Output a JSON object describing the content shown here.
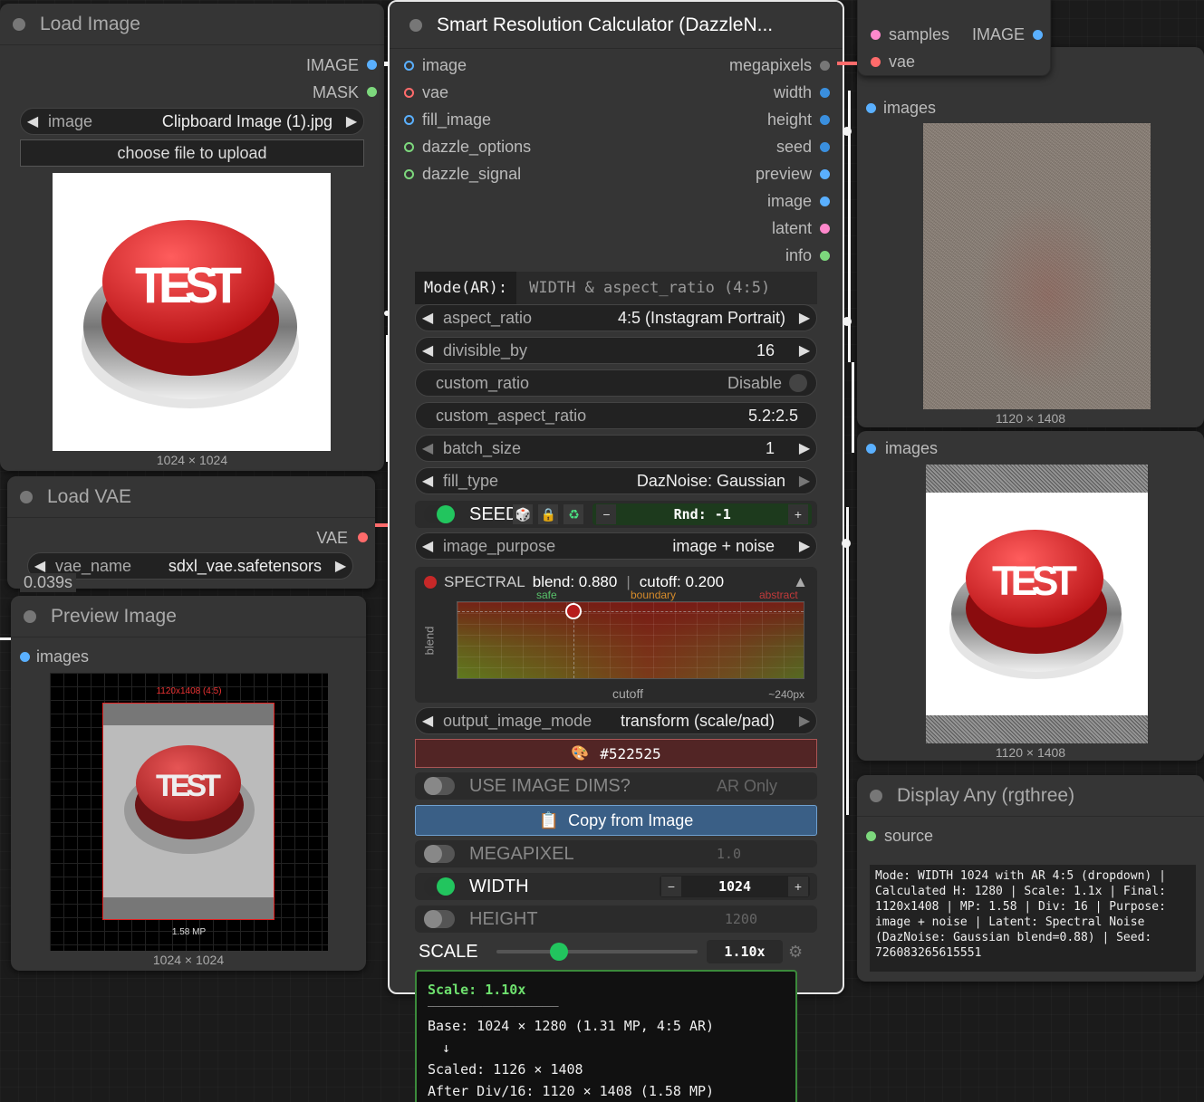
{
  "load_image": {
    "title": "Load Image",
    "outputs": [
      {
        "label": "IMAGE",
        "color": "#5ab0ff"
      },
      {
        "label": "MASK",
        "color": "#7dd87d"
      }
    ],
    "image_widget": {
      "label": "image",
      "value": "Clipboard Image (1).jpg"
    },
    "upload_button": "choose file to upload",
    "preview_button_text": "TEST",
    "dims": "1024 × 1024"
  },
  "load_vae": {
    "title": "Load VAE",
    "output": {
      "label": "VAE",
      "color": "#ff6b6b"
    },
    "vae_widget": {
      "label": "vae_name",
      "value": "sdxl_vae.safetensors"
    },
    "timing": "0.039s"
  },
  "preview_image": {
    "title": "Preview Image",
    "input": {
      "label": "images",
      "color": "#5ab0ff"
    },
    "overlay_label": "1120x1408 (4:5)",
    "overlay_mp": "1.58 MP",
    "button_text": "TEST",
    "dims": "1024 × 1024"
  },
  "calculator": {
    "title": "Smart Resolution Calculator (DazzleN...",
    "inputs": [
      {
        "label": "image",
        "color": "#5ab0ff",
        "hollow": true
      },
      {
        "label": "vae",
        "color": "#ff6b6b",
        "hollow": true
      },
      {
        "label": "fill_image",
        "color": "#5ab0ff",
        "hollow": true
      },
      {
        "label": "dazzle_options",
        "color": "#7dd87d",
        "hollow": true
      },
      {
        "label": "dazzle_signal",
        "color": "#7dd87d",
        "hollow": true
      }
    ],
    "outputs": [
      {
        "label": "megapixels",
        "color": "#888888"
      },
      {
        "label": "width",
        "color": "#3a8fde"
      },
      {
        "label": "height",
        "color": "#3a8fde"
      },
      {
        "label": "seed",
        "color": "#3a8fde"
      },
      {
        "label": "preview",
        "color": "#5ab0ff"
      },
      {
        "label": "image",
        "color": "#5ab0ff"
      },
      {
        "label": "latent",
        "color": "#ff88cc"
      },
      {
        "label": "info",
        "color": "#7dd87d"
      }
    ],
    "mode_label": "Mode(AR):",
    "mode_value": "WIDTH & aspect_ratio (4:5)",
    "widgets": {
      "aspect_ratio": {
        "label": "aspect_ratio",
        "value": "4:5 (Instagram Portrait)"
      },
      "divisible_by": {
        "label": "divisible_by",
        "value": "16"
      },
      "custom_ratio": {
        "label": "custom_ratio",
        "value": "Disable"
      },
      "custom_aspect_ratio": {
        "label": "custom_aspect_ratio",
        "value": "5.2:2.5"
      },
      "batch_size": {
        "label": "batch_size",
        "value": "1"
      },
      "fill_type": {
        "label": "fill_type",
        "value": "DazNoise: Gaussian"
      },
      "image_purpose": {
        "label": "image_purpose",
        "value": "image + noise"
      },
      "output_image_mode": {
        "label": "output_image_mode",
        "value": "transform (scale/pad)"
      }
    },
    "seed": {
      "label": "SEED",
      "value": "Rnd: -1",
      "minus": "−",
      "plus": "+"
    },
    "spectral": {
      "label": "SPECTRAL",
      "blend": "blend: 0.880",
      "cutoff": "cutoff: 0.200",
      "zone_safe": "safe",
      "zone_boundary": "boundary",
      "zone_abstract": "abstract",
      "y_axis": "blend",
      "x_axis": "cutoff",
      "x_right": "~240px",
      "blend_value": 0.88,
      "cutoff_value": 0.2
    },
    "color_swatch": "#522525",
    "use_image_dims": {
      "label": "USE IMAGE DIMS?",
      "value": "AR Only"
    },
    "copy_button": "Copy from Image",
    "megapixel": {
      "label": "MEGAPIXEL",
      "value": "1.0"
    },
    "width": {
      "label": "WIDTH",
      "value": "1024",
      "minus": "−",
      "plus": "+"
    },
    "height": {
      "label": "HEIGHT",
      "value": "1200"
    },
    "scale": {
      "label": "SCALE",
      "value": "1.10x",
      "level": 0.31
    },
    "tooltip": {
      "title": "Scale: 1.10x",
      "rule": "────────────────────────",
      "base": "Base: 1024 × 1280 (1.31 MP, 4:5 AR)",
      "arrow": "↓",
      "scaled": "Scaled: 1126 × 1408",
      "after": "After Div/16: 1120 × 1408 (1.58 MP)"
    }
  },
  "vae_decode": {
    "inputs": [
      {
        "label": "samples",
        "color": "#ff88cc"
      },
      {
        "label": "vae",
        "color": "#ff6b6b"
      }
    ],
    "output": {
      "label": "IMAGE",
      "color": "#5ab0ff"
    }
  },
  "preview_top_right": {
    "input": {
      "label": "images",
      "color": "#5ab0ff"
    },
    "dims": "1120 × 1408"
  },
  "preview_mid_right": {
    "input": {
      "label": "images",
      "color": "#5ab0ff"
    },
    "button_text": "TEST",
    "dims": "1120 × 1408"
  },
  "display_any": {
    "title": "Display Any (rgthree)",
    "input": {
      "label": "source",
      "color": "#7dd87d"
    },
    "text": "Mode: WIDTH 1024 with AR 4:5 (dropdown) | Calculated H: 1280 | Scale: 1.1x | Final: 1120x1408 | MP: 1.58 | Div: 16 | Purpose: image + noise | Latent: Spectral Noise (DazNoise: Gaussian blend=0.88) | Seed: 726083265615551"
  }
}
